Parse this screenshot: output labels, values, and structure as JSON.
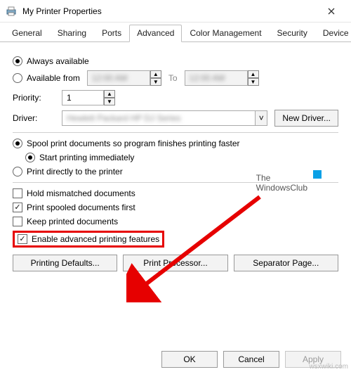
{
  "window": {
    "title": "My Printer Properties"
  },
  "tabs": [
    "General",
    "Sharing",
    "Ports",
    "Advanced",
    "Color Management",
    "Security",
    "Device Settings"
  ],
  "activeTab": 3,
  "availability": {
    "always": "Always available",
    "from": "Available from",
    "toLabel": "To",
    "fromTime": "12:00 AM",
    "toTime": "12:00 AM"
  },
  "priority": {
    "label": "Priority:",
    "value": "1"
  },
  "driver": {
    "label": "Driver:",
    "value": "Hewlett Packard HP DJ Series",
    "newDriver": "New Driver..."
  },
  "spool": {
    "spool": "Spool print documents so program finishes printing faster",
    "startImmediate": "Start printing immediately",
    "direct": "Print directly to the printer"
  },
  "options": {
    "hold": "Hold mismatched documents",
    "spooledFirst": "Print spooled documents first",
    "keep": "Keep printed documents",
    "advanced": "Enable advanced printing features"
  },
  "buttons": {
    "defaults": "Printing Defaults...",
    "processor": "Print Processor...",
    "separator": "Separator Page...",
    "ok": "OK",
    "cancel": "Cancel",
    "apply": "Apply"
  },
  "watermark": {
    "line1": "The",
    "line2": "WindowsClub"
  },
  "landmark": "wsxwiki.com"
}
